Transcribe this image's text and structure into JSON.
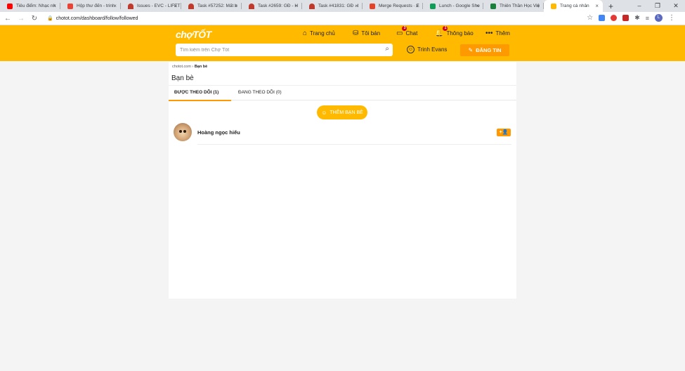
{
  "browser": {
    "tabs": [
      {
        "title": "Tiêu điểm: Nhạc nh",
        "color": "#ff0000"
      },
      {
        "title": "Hộp thư đến - trinh",
        "color": "#ea4335"
      },
      {
        "title": "Issues - EVC - LIFET",
        "color": "#c0392b"
      },
      {
        "title": "Task #57252: Mất b",
        "color": "#c0392b"
      },
      {
        "title": "Task #2659: GĐ - H",
        "color": "#c0392b"
      },
      {
        "title": "Task #41831: GĐ - l",
        "color": "#c0392b"
      },
      {
        "title": "Merge Requests · E",
        "color": "#e24329"
      },
      {
        "title": "Lunch - Google She",
        "color": "#0f9d58"
      },
      {
        "title": "Thiên Thần Học Việ",
        "color": "#188038"
      },
      {
        "title": "Trang cá nhân",
        "color": "#ffba00"
      }
    ],
    "new_tab": "+",
    "close_glyph": "×",
    "window_controls": [
      "–",
      "❐",
      "✕"
    ],
    "url": "chotot.com/dashboard/follow/followed",
    "profile_initial": "L"
  },
  "header": {
    "logo": "chợTỐT",
    "nav": {
      "home": "Trang chủ",
      "selling": "Tôi bán",
      "chat": "Chat",
      "chat_badge": "3",
      "notifications": "Thông báo",
      "notifications_badge": "1",
      "more": "Thêm"
    },
    "search_placeholder": "Tìm kiếm trên Chợ Tốt",
    "user_name": "Trinh Evans",
    "post_button": "ĐĂNG TIN"
  },
  "page": {
    "breadcrumb_root": "chotot.com",
    "breadcrumb_sep": "›",
    "breadcrumb_current": "Bạn bè",
    "title": "Bạn bè",
    "tabs": {
      "followed": "ĐƯỢC THEO DÕI (1)",
      "following": "ĐANG THEO DÕI (0)"
    },
    "add_friend": "THÊM BẠN BÈ",
    "friends": [
      {
        "name": "Hoàng ngọc hiếu",
        "action": "+👤"
      }
    ]
  }
}
